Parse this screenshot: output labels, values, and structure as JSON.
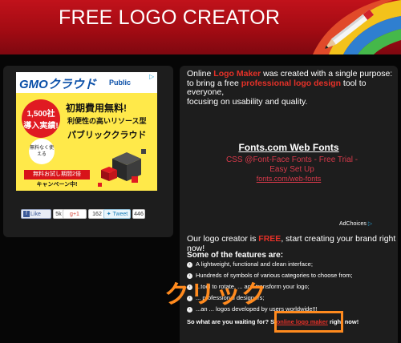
{
  "header": {
    "title": "FREE LOGO CREATOR"
  },
  "ad": {
    "brand": "GMOクラウド",
    "brand_sub": "Public",
    "badge_line1": "1,500社",
    "badge_line2": "導入実績!",
    "free_badge": "無料なく使える",
    "line1": "初期費用無料!",
    "line2": "利便性の高いリソース型",
    "line3": "パブリッククラウド",
    "button1": "無料お試し期間2倍",
    "button2": "キャンペーン中!"
  },
  "social": {
    "like_label": "Like",
    "like_count": "5k",
    "gplus_label": "+1",
    "gplus_count": "162",
    "tweet_label": "Tweet",
    "tweet_count": "446"
  },
  "intro": {
    "prefix": "Online ",
    "logo_maker": "Logo Maker",
    "middle": " was created with a single purpose:",
    "line2_prefix": "to bring a free ",
    "design_link": "professional logo design",
    "line2_suffix": " tool to everyone,",
    "line3": "focusing on usability and quality."
  },
  "fonts_ad": {
    "title": "Fonts.com Web Fonts",
    "desc": "CSS @Font-Face Fonts - Free Trial - Easy Set Up",
    "url": "fonts.com/web-fonts"
  },
  "adchoices": "AdChoices",
  "free_line": {
    "prefix": "Our logo creator is ",
    "free": "FREE",
    "suffix": ", start creating your brand right now!"
  },
  "features": {
    "title": "Some of the features are:",
    "items": [
      "A lightweight, functional and clean interface;",
      "Hundreds of symbols of various categories to choose from;",
      "...tool to rotate, ... and transform your logo;",
      "... professional designers;",
      "...an ... logos developed by users worldwide!!!"
    ]
  },
  "cta": {
    "prefix": "So what are you waiting for? St",
    "link": "online logo maker",
    "suffix": " right now!"
  },
  "overlay": {
    "label": "クリック",
    "color": "#ff8a1e"
  },
  "colors": {
    "header_red": "#c1121b",
    "accent_red": "#e53128",
    "panel_bg": "#1d1d1d"
  }
}
